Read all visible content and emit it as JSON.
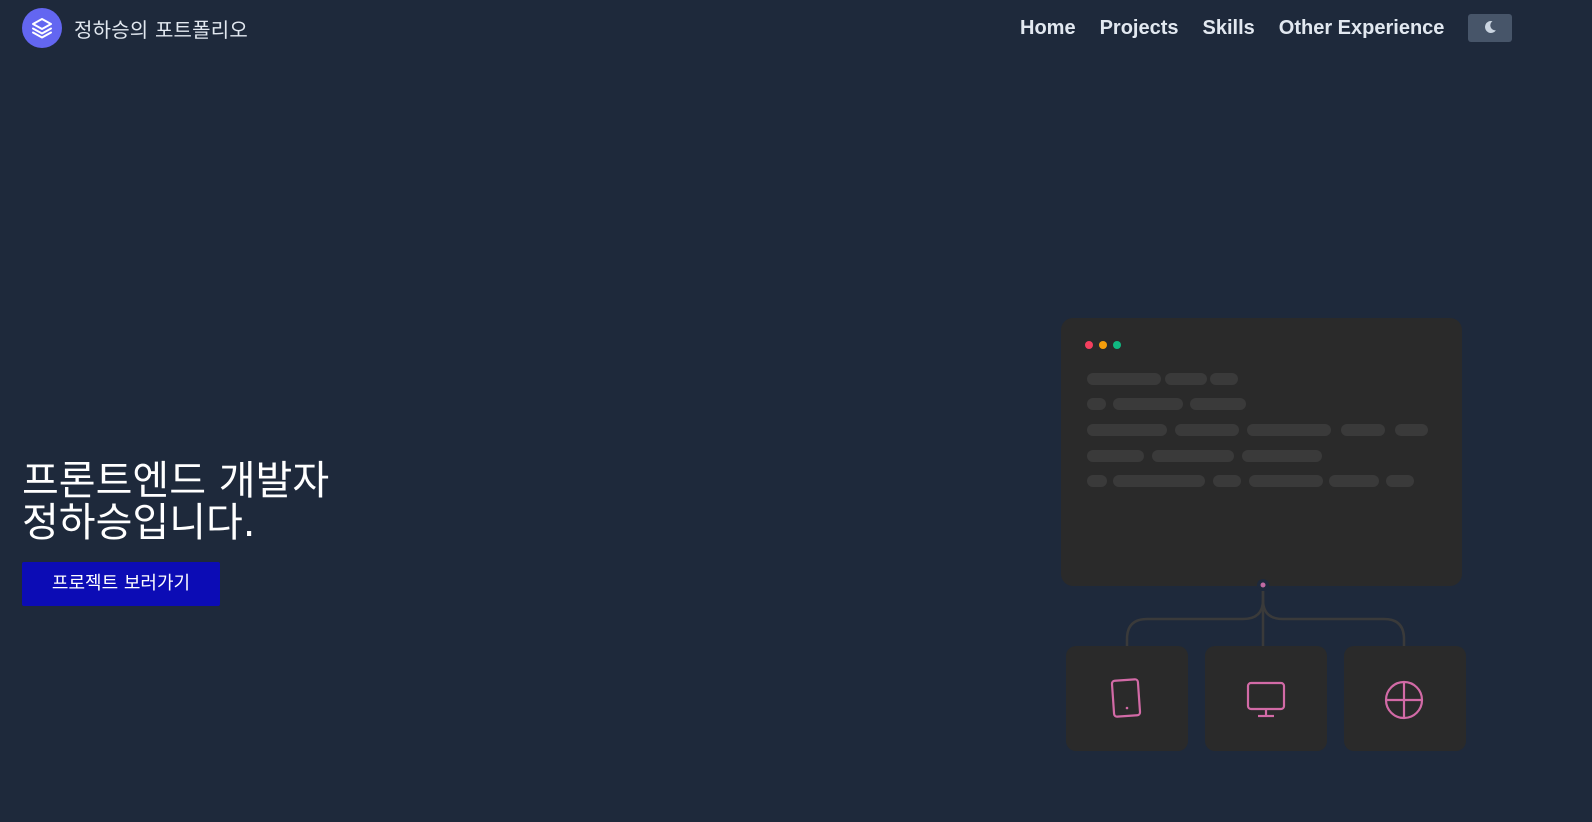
{
  "header": {
    "brand_title": "정하승의 포트폴리오",
    "nav": [
      "Home",
      "Projects",
      "Skills",
      "Other Experience"
    ],
    "theme_icon": "moon-icon"
  },
  "hero": {
    "title_line1": "프론트엔드 개발자",
    "title_line2": "정하승입니다.",
    "cta_label": "프로젝트 보러가기"
  },
  "illustration": {
    "window_dots": [
      "#f43f5e",
      "#f59e0b",
      "#10b981"
    ],
    "device_icons": [
      "tablet-icon",
      "monitor-icon",
      "globe-icon"
    ],
    "accent": "#db6fb0"
  },
  "colors": {
    "background": "#1e293b",
    "accent": "#6366f1",
    "cta": "#0c0cb5"
  }
}
